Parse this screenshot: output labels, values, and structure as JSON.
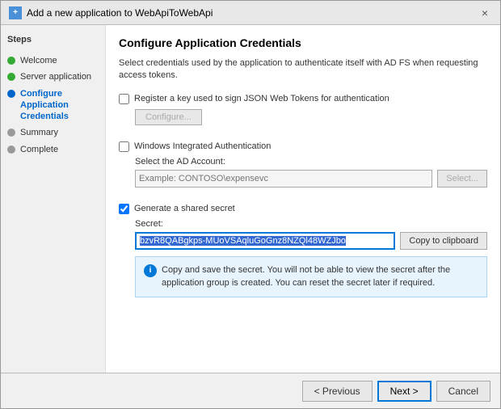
{
  "titleBar": {
    "icon": "+",
    "title": "Add a new application to WebApiToWebApi",
    "closeLabel": "×"
  },
  "sidebar": {
    "title": "Steps",
    "items": [
      {
        "id": "welcome",
        "label": "Welcome",
        "status": "green",
        "active": false
      },
      {
        "id": "server-application",
        "label": "Server application",
        "status": "green",
        "active": false
      },
      {
        "id": "configure-credentials",
        "label": "Configure Application Credentials",
        "status": "blue",
        "active": true
      },
      {
        "id": "summary",
        "label": "Summary",
        "status": "gray",
        "active": false
      },
      {
        "id": "complete",
        "label": "Complete",
        "status": "gray",
        "active": false
      }
    ]
  },
  "main": {
    "title": "Configure Application Credentials",
    "description": "Select credentials used by the application to authenticate itself with AD FS when requesting access tokens.",
    "sections": {
      "jsonToken": {
        "checkboxLabel": "Register a key used to sign JSON Web Tokens for authentication",
        "configureLabel": "Configure..."
      },
      "windowsAuth": {
        "checkboxLabel": "Windows Integrated Authentication",
        "adAccountLabel": "Select the AD Account:",
        "adAccountPlaceholder": "Example: CONTOSO\\expensevc",
        "selectLabel": "Select..."
      },
      "sharedSecret": {
        "checkboxLabel": "Generate a shared secret",
        "secretLabel": "Secret:",
        "secretValue": "bzvR8QABgkps-MUoVSAqluGoGnz8NZQl48WZJbo",
        "copyLabel": "Copy to clipboard",
        "infoText": "Copy and save the secret.  You will not be able to view the secret after the application group is created.  You can reset the secret later if required."
      }
    }
  },
  "footer": {
    "previousLabel": "< Previous",
    "nextLabel": "Next >",
    "cancelLabel": "Cancel"
  }
}
